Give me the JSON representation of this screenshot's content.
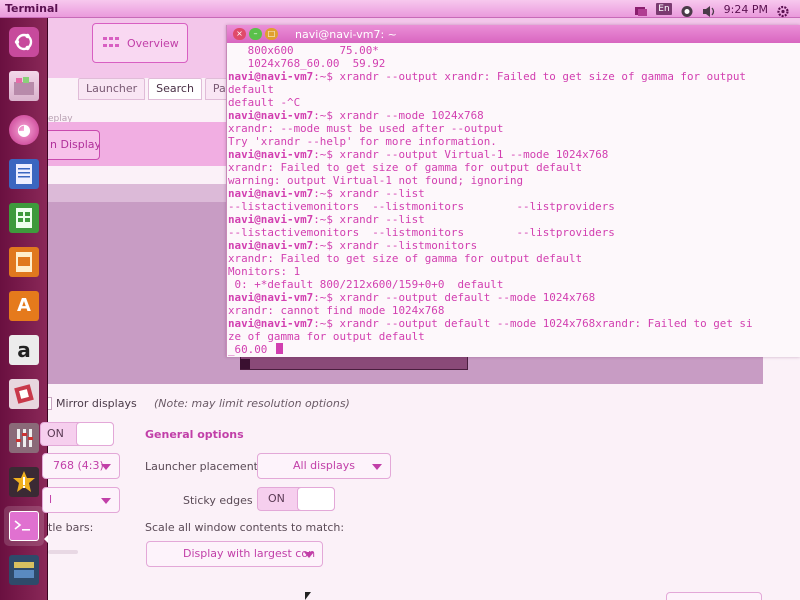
{
  "top_panel": {
    "title": "Terminal",
    "keyboard_layout": "En",
    "clock": "9:24 PM"
  },
  "launcher": {
    "icons": [
      "ubuntu-dash-icon",
      "files-icon",
      "firefox-icon",
      "writer-icon",
      "calc-icon",
      "impress-icon",
      "software-center-icon",
      "amazon-icon",
      "settings-icon",
      "system-settings-icon",
      "update-manager-icon",
      "terminal-icon",
      "workspaces-icon"
    ]
  },
  "settings": {
    "overview_label": "Overview",
    "tabs": [
      "Launcher",
      "Search",
      "Panel"
    ],
    "display_fragment": "eplay",
    "detect_button": "n Display",
    "mirror_label": "Mirror displays",
    "mirror_note": "(Note: may limit resolution options)",
    "on_label": "ON",
    "resolution_fragment": "768 (4:3)",
    "rotation_fragment": "l",
    "title_bars_fragment": "tle bars:",
    "general_options": "General options",
    "launcher_placement_label": "Launcher placement",
    "launcher_placement_value": "All displays",
    "sticky_edges_label": "Sticky edges",
    "sticky_edges_value": "ON",
    "scale_label": "Scale all window contents to match:",
    "scale_value": "Display with largest con"
  },
  "terminal": {
    "title": "navi@navi-vm7: ~",
    "lines": [
      {
        "p": "",
        "t": "   800x600       75.00*"
      },
      {
        "p": "",
        "t": "   1024x768_60.00  59.92"
      },
      {
        "p": "navi@navi-vm7",
        "t": ":~$ xrandr --output xrandr: Failed to get size of gamma for output"
      },
      {
        "p": "",
        "t": "default"
      },
      {
        "p": "",
        "t": "default -^C"
      },
      {
        "p": "navi@navi-vm7",
        "t": ":~$ xrandr --mode 1024x768"
      },
      {
        "p": "",
        "t": "xrandr: --mode must be used after --output"
      },
      {
        "p": "",
        "t": "Try 'xrandr --help' for more information."
      },
      {
        "p": "navi@navi-vm7",
        "t": ":~$ xrandr --output Virtual-1 --mode 1024x768"
      },
      {
        "p": "",
        "t": "xrandr: Failed to get size of gamma for output default"
      },
      {
        "p": "",
        "t": "warning: output Virtual-1 not found; ignoring"
      },
      {
        "p": "navi@navi-vm7",
        "t": ":~$ xrandr --list"
      },
      {
        "p": "",
        "t": "--listactivemonitors  --listmonitors        --listproviders"
      },
      {
        "p": "navi@navi-vm7",
        "t": ":~$ xrandr --list"
      },
      {
        "p": "",
        "t": "--listactivemonitors  --listmonitors        --listproviders"
      },
      {
        "p": "navi@navi-vm7",
        "t": ":~$ xrandr --listmonitors"
      },
      {
        "p": "",
        "t": "xrandr: Failed to get size of gamma for output default"
      },
      {
        "p": "",
        "t": "Monitors: 1"
      },
      {
        "p": "",
        "t": " 0: +*default 800/212x600/159+0+0  default"
      },
      {
        "p": "navi@navi-vm7",
        "t": ":~$ xrandr --output default --mode 1024x768"
      },
      {
        "p": "",
        "t": "xrandr: cannot find mode 1024x768"
      },
      {
        "p": "navi@navi-vm7",
        "t": ":~$ xrandr --output default --mode 1024x768xrandr: Failed to get si"
      },
      {
        "p": "",
        "t": "ze of gamma for output default"
      },
      {
        "p": "",
        "t": "_60.00 "
      }
    ]
  }
}
